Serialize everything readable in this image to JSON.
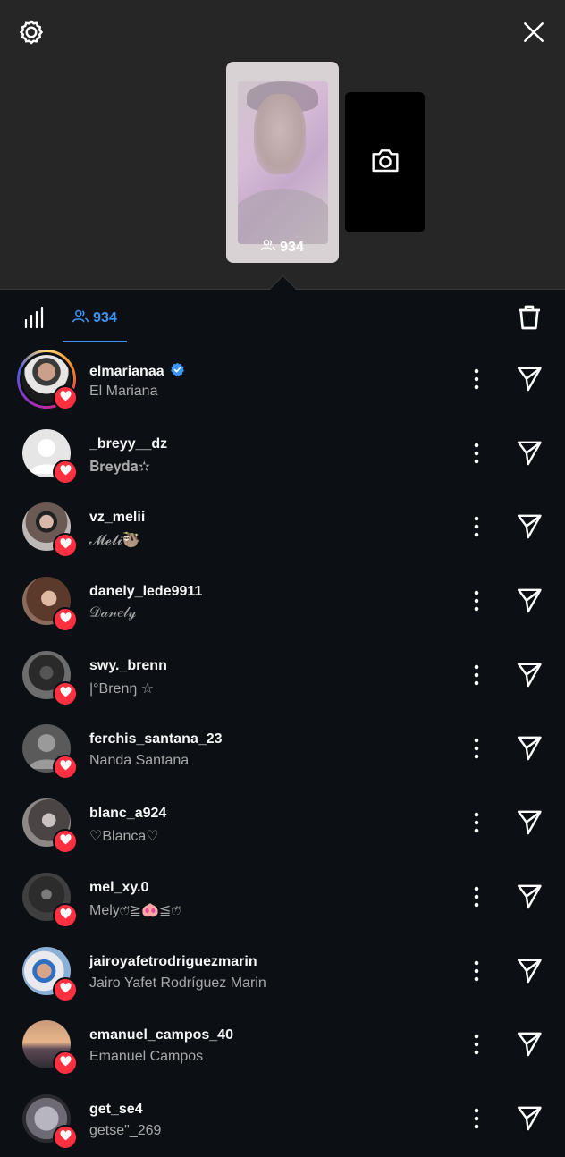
{
  "story": {
    "viewer_count": "934"
  },
  "tabs": {
    "viewers_count": "934"
  },
  "viewers": [
    {
      "username": "elmarianaa",
      "name": "El Mariana",
      "verified": true,
      "ring": true,
      "avatar": "photo-man-dark-shirt"
    },
    {
      "username": "_breyy__dz",
      "name": "𝐁𝐫𝐞𝐲𝐝𝐚✫",
      "verified": false,
      "ring": false,
      "avatar": "default"
    },
    {
      "username": "vz_melii",
      "name": "𝓜𝓮𝓵𝓲🦥",
      "verified": false,
      "ring": false,
      "avatar": "photo-girl-sunglasses"
    },
    {
      "username": "danely_lede9911",
      "name": "𝒟𝒶𝓃𝑒𝓁𝓎",
      "verified": false,
      "ring": false,
      "avatar": "photo-girl-brown-hair"
    },
    {
      "username": "swy._brenn",
      "name": "|°Brenŋ ☆",
      "verified": false,
      "ring": false,
      "avatar": "photo-dark-selfie"
    },
    {
      "username": "ferchis_santana_23",
      "name": "Nanda Santana",
      "verified": false,
      "ring": false,
      "avatar": "default-dark"
    },
    {
      "username": "blanc_a924",
      "name": "♡Blanca♡",
      "verified": false,
      "ring": false,
      "avatar": "photo-girl-grey"
    },
    {
      "username": "mel_xy.0",
      "name": "Melyෆ̈≧🐽≦ෆ̈",
      "verified": false,
      "ring": false,
      "avatar": "photo-dark-phone"
    },
    {
      "username": "jairoyafetrodriguezmarin",
      "name": "Jairo Yafet Rodríguez Marin",
      "verified": false,
      "ring": false,
      "avatar": "photo-boy-blue-cap"
    },
    {
      "username": "emanuel_campos_40",
      "name": "Emanuel Campos",
      "verified": false,
      "ring": false,
      "avatar": "photo-sunset"
    },
    {
      "username": "get_se4",
      "name": "getse\"_269",
      "verified": false,
      "ring": false,
      "avatar": "photo-heart-grey"
    }
  ],
  "colors": {
    "accent": "#3c95f4",
    "like": "#ff3040",
    "background": "#0c1014",
    "header_bg": "#262626",
    "subtext": "#a8a8a8"
  },
  "icons": [
    "settings-icon",
    "close-icon",
    "camera-icon",
    "viewers-icon",
    "stats-icon",
    "trash-icon",
    "verified-icon",
    "more-icon",
    "send-icon",
    "heart-icon"
  ]
}
